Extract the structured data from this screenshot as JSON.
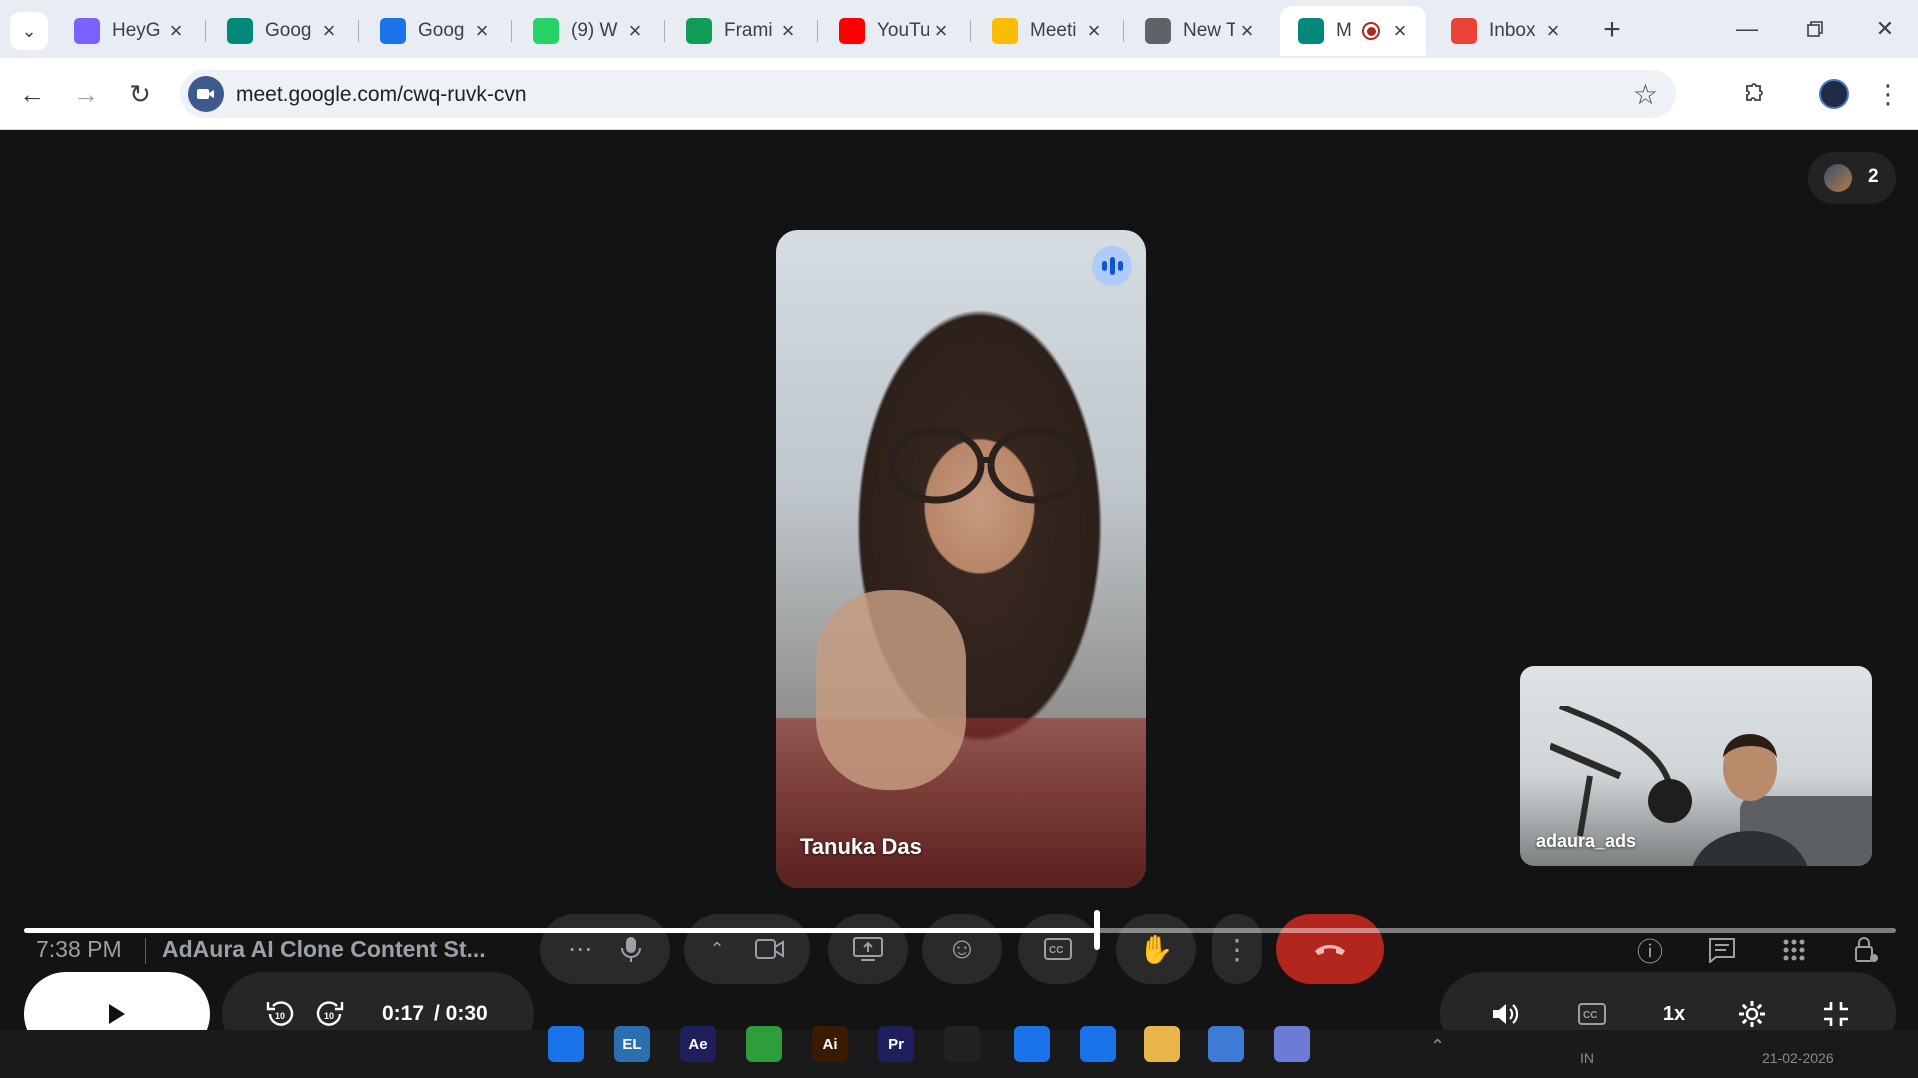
{
  "browser": {
    "tabs": [
      {
        "label": "HeyG",
        "icon": "heygen-icon",
        "color": "#7b61ff"
      },
      {
        "label": "Goog",
        "icon": "google-meet-icon",
        "color": "#00897b"
      },
      {
        "label": "Goog",
        "icon": "google-calendar-icon",
        "color": "#1a73e8"
      },
      {
        "label": "(9) W",
        "icon": "whatsapp-icon",
        "color": "#25d366"
      },
      {
        "label": "Frami",
        "icon": "google-sheets-icon",
        "color": "#0f9d58"
      },
      {
        "label": "YouTu",
        "icon": "youtube-icon",
        "color": "#ff0000"
      },
      {
        "label": "Meeti",
        "icon": "google-drive-icon",
        "color": "#fbbc04"
      },
      {
        "label": "New T",
        "icon": "chrome-icon",
        "color": "#5f6368"
      },
      {
        "label": "M",
        "icon": "google-meet-icon",
        "color": "#00897b",
        "active": true
      },
      {
        "label": "Inbox",
        "icon": "gmail-icon",
        "color": "#ea4335"
      }
    ],
    "url": "meet.google.com/cwq-ruvk-cvn"
  },
  "meeting": {
    "participant_count": "2",
    "main_participant": "Tanuka Das",
    "self_participant": "adaura_ads",
    "clock": "7:38 PM",
    "title": "AdAura AI Clone Content St..."
  },
  "player": {
    "current_time": "0:17",
    "duration": "/ 0:30",
    "progress": 0.573,
    "speed": "1x"
  },
  "taskbar": {
    "apps": [
      {
        "label": "",
        "icon": "chrome-icon",
        "color": "#1a73e8"
      },
      {
        "label": "EL",
        "icon": "elevenlabs-icon",
        "color": "#2a6fb0"
      },
      {
        "label": "Ae",
        "icon": "after-effects-icon",
        "color": "#1f1f5e"
      },
      {
        "label": "",
        "icon": "pen-icon",
        "color": "#2e9e3c"
      },
      {
        "label": "Ai",
        "icon": "illustrator-icon",
        "color": "#3a1a00"
      },
      {
        "label": "Pr",
        "icon": "premiere-icon",
        "color": "#1f1f5e"
      },
      {
        "label": "",
        "icon": "capcut-icon",
        "color": "#222222"
      },
      {
        "label": "",
        "icon": "chrome-icon",
        "color": "#1a73e8"
      },
      {
        "label": "",
        "icon": "chrome-icon",
        "color": "#1a73e8"
      },
      {
        "label": "",
        "icon": "file-explorer-icon",
        "color": "#e8b64a"
      },
      {
        "label": "",
        "icon": "notepad-icon",
        "color": "#3e7bd6"
      },
      {
        "label": "",
        "icon": "snipping-tool-icon",
        "color": "#6b7bd6"
      }
    ],
    "lang": "IN",
    "date": "21-02-2026"
  },
  "colors": {
    "stage_bg": "#131313",
    "end_call": "#b3261e",
    "speaking_indicator": "#aecbfa"
  }
}
